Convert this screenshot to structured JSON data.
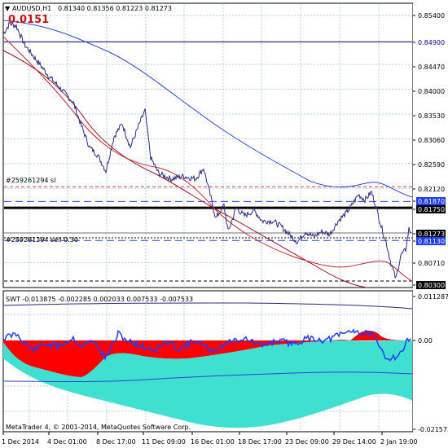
{
  "window": {
    "symbol_title": "AUDUSD,H1",
    "ohlc": "0.81340 0.81356 0.81223 0.81273",
    "spread_badge": "0.0151",
    "collapse_arrow": "triangle-down-icon",
    "copyright": "MetaTrader 4, © 2001-2014, MetaQuotes Software Corp."
  },
  "main_chart": {
    "order_labels": [
      "#259261294 sl",
      "#259261294 sell 0.30"
    ],
    "price_ticks": [
      "0.85400",
      "0.84900",
      "0.84470",
      "0.84000",
      "0.83530",
      "0.83060",
      "0.82590",
      "0.82120",
      "0.81870",
      "0.81750",
      "0.81273",
      "0.81130",
      "0.80710",
      "0.80300"
    ],
    "highlighted_ticks": [
      {
        "value": "0.84900",
        "bg": "#ffffff",
        "fg": "#00008b"
      },
      {
        "value": "0.81870",
        "bg": "#1e3cff",
        "fg": "#ffffff"
      },
      {
        "value": "0.81750",
        "bg": "#000000",
        "fg": "#ffffff"
      },
      {
        "value": "0.81273",
        "bg": "#000000",
        "fg": "#ffffff"
      },
      {
        "value": "0.81130",
        "bg": "#1e3cff",
        "fg": "#ffffff"
      },
      {
        "value": "0.80300",
        "bg": "#000000",
        "fg": "#ffffff"
      }
    ]
  },
  "sub_chart": {
    "title": "SWT -0.013875 -0.002285 0.002033 0.007533 -0.007533",
    "scale_ticks": [
      "0.011287",
      "0.00",
      "-0.021573"
    ]
  },
  "time_axis": {
    "labels": [
      "1 Dec 2014",
      "4 Dec 01:00",
      "8 Dec 17:00",
      "11 Dec 09:00",
      "16 Dec 01:00",
      "18 Dec 17:00",
      "23 Dec 09:00",
      "29 Dec 14:00",
      "2 Jan 19:00"
    ]
  },
  "colors": {
    "price_line": "#2b2b80",
    "ma_fast": "#cc2030",
    "ma_slow": "#2b45d6",
    "red_fill": "#ff0000",
    "cyan_fill": "#40e0d0",
    "grid": "#b4d0ea"
  }
}
